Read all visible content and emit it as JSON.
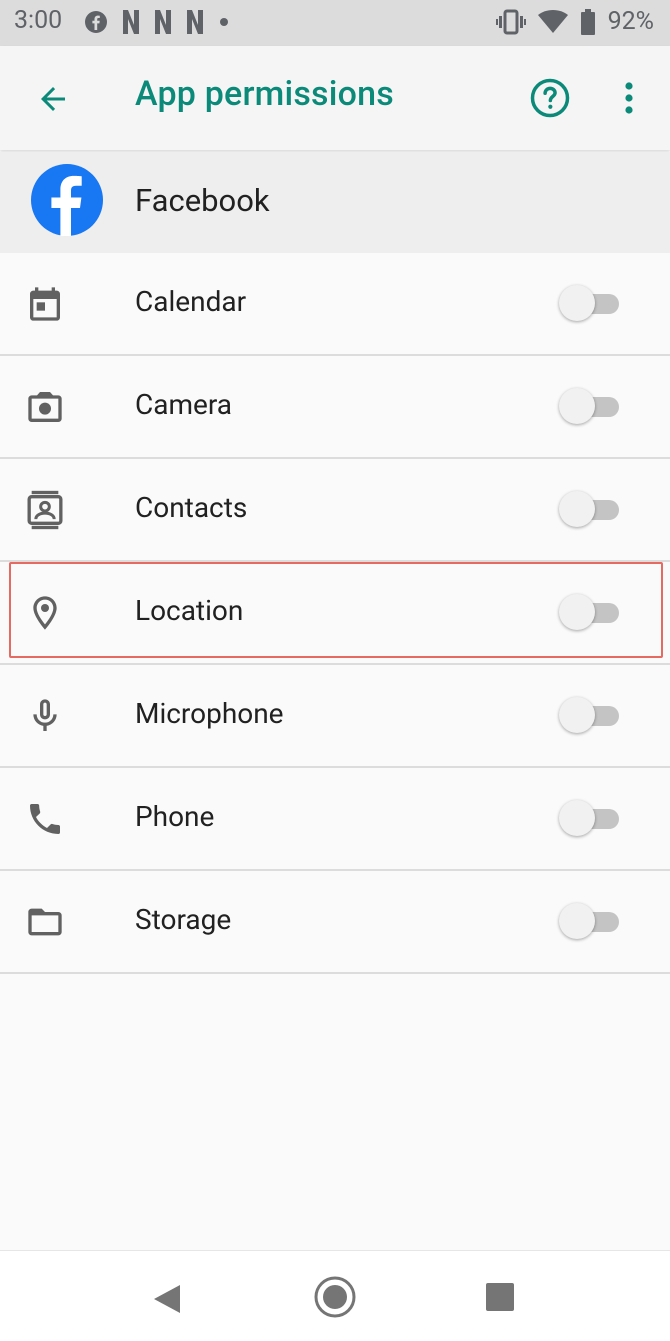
{
  "status_bar": {
    "time": "3:00",
    "left_icons": [
      "facebook-icon",
      "netflix-icon",
      "netflix-icon",
      "netflix-icon",
      "dot-icon"
    ],
    "right_icons": [
      "vibrate-icon",
      "wifi-icon",
      "battery-icon"
    ],
    "battery": "92%"
  },
  "app_bar": {
    "title": "App permissions",
    "accent_color": "#0b8a7a"
  },
  "app": {
    "name": "Facebook",
    "brand_color": "#1877f2"
  },
  "permissions": [
    {
      "label": "Calendar",
      "icon": "calendar-icon",
      "enabled": false
    },
    {
      "label": "Camera",
      "icon": "camera-icon",
      "enabled": false
    },
    {
      "label": "Contacts",
      "icon": "contacts-icon",
      "enabled": false
    },
    {
      "label": "Location",
      "icon": "location-icon",
      "enabled": false
    },
    {
      "label": "Microphone",
      "icon": "microphone-icon",
      "enabled": false
    },
    {
      "label": "Phone",
      "icon": "phone-icon",
      "enabled": false
    },
    {
      "label": "Storage",
      "icon": "folder-icon",
      "enabled": false
    }
  ],
  "highlight_color": "#e56a62",
  "nav_bar": {
    "buttons": [
      "back-triangle-icon",
      "home-circle-icon",
      "recents-square-icon"
    ]
  }
}
